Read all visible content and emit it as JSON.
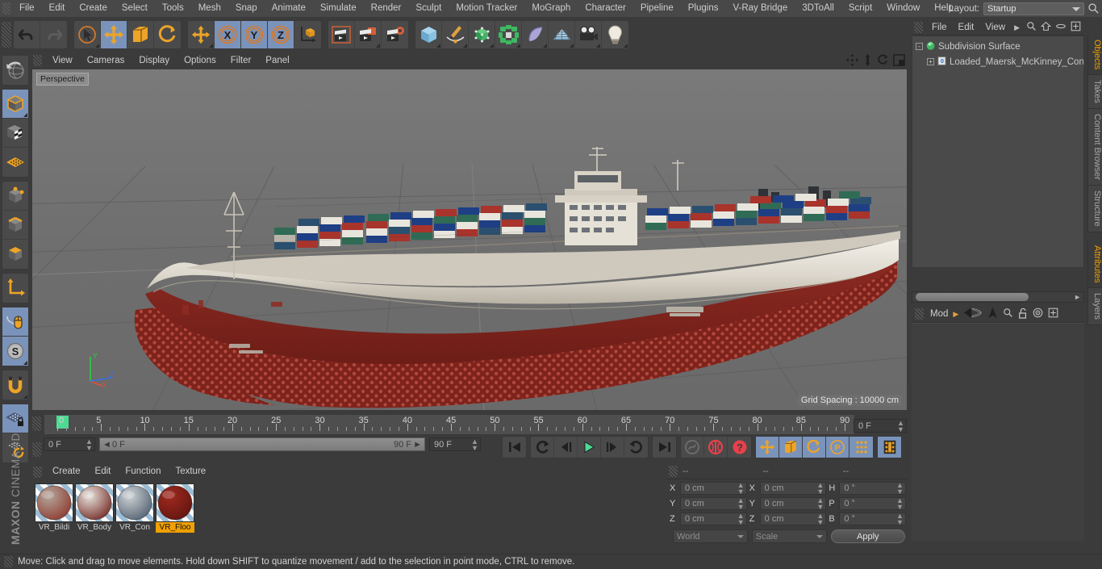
{
  "app": {
    "title": "MAXON CINEMA 4D",
    "brand_top": "MAXON",
    "brand_bottom": "CINEMA 4D"
  },
  "menubar": {
    "items": [
      "File",
      "Edit",
      "Create",
      "Select",
      "Tools",
      "Mesh",
      "Snap",
      "Animate",
      "Simulate",
      "Render",
      "Sculpt",
      "Motion Tracker",
      "MoGraph",
      "Character",
      "Pipeline",
      "Plugins",
      "V-Ray Bridge",
      "3DToAll",
      "Script",
      "Window",
      "Help"
    ],
    "layout_label": "Layout:",
    "layout_value": "Startup",
    "search_icon": "search-icon"
  },
  "main_toolbar": {
    "groups": [
      {
        "name": "history",
        "buttons": [
          {
            "name": "undo",
            "icon": "undo-icon",
            "selected": false,
            "has_corner": false
          },
          {
            "name": "redo",
            "icon": "redo-icon",
            "selected": false,
            "has_corner": false
          }
        ]
      },
      {
        "name": "transform-tools",
        "buttons": [
          {
            "name": "live-selection",
            "icon": "live-selection-icon",
            "selected": false,
            "has_corner": true
          },
          {
            "name": "move",
            "icon": "move-icon",
            "selected": true,
            "has_corner": false
          },
          {
            "name": "scale",
            "icon": "scale-icon",
            "selected": false,
            "has_corner": false
          },
          {
            "name": "rotate",
            "icon": "rotate-icon",
            "selected": false,
            "has_corner": false
          }
        ]
      },
      {
        "name": "axis-lock",
        "buttons": [
          {
            "name": "move-alt",
            "icon": "move-icon",
            "selected": false,
            "has_corner": true
          },
          {
            "name": "lock-x",
            "icon": "x-axis-icon",
            "label": "X",
            "selected": true,
            "has_corner": false
          },
          {
            "name": "lock-y",
            "icon": "y-axis-icon",
            "label": "Y",
            "selected": true,
            "has_corner": false
          },
          {
            "name": "lock-z",
            "icon": "z-axis-icon",
            "label": "Z",
            "selected": true,
            "has_corner": false
          },
          {
            "name": "world-coordinate-system",
            "icon": "world-axis-icon",
            "selected": false,
            "has_corner": false
          }
        ]
      },
      {
        "name": "render",
        "buttons": [
          {
            "name": "render-view",
            "icon": "render-view-icon",
            "selected": false,
            "has_corner": false
          },
          {
            "name": "render-to-picture-viewer",
            "icon": "render-picture-viewer-icon",
            "selected": false,
            "has_corner": true
          },
          {
            "name": "edit-render-settings",
            "icon": "render-settings-icon",
            "selected": false,
            "has_corner": false
          }
        ]
      },
      {
        "name": "create",
        "buttons": [
          {
            "name": "add-cube-object",
            "icon": "cube-icon",
            "selected": false,
            "has_corner": true
          },
          {
            "name": "add-spline",
            "icon": "pen-spline-icon",
            "selected": false,
            "has_corner": true
          },
          {
            "name": "add-generator",
            "icon": "generator-icon",
            "selected": false,
            "has_corner": true
          },
          {
            "name": "add-mograph",
            "icon": "mograph-icon",
            "selected": false,
            "has_corner": true
          },
          {
            "name": "add-deformer",
            "icon": "deformer-icon",
            "selected": false,
            "has_corner": true
          },
          {
            "name": "add-environment",
            "icon": "floor-environment-icon",
            "selected": false,
            "has_corner": true
          },
          {
            "name": "add-camera",
            "icon": "camera-icon",
            "selected": false,
            "has_corner": true
          },
          {
            "name": "add-light",
            "icon": "light-bulb-icon",
            "selected": false,
            "has_corner": true
          }
        ]
      }
    ]
  },
  "left_toolbar": {
    "groups": [
      {
        "name": "undo-view",
        "buttons": [
          {
            "name": "undo-view",
            "icon": "globe-undo-icon",
            "selected": false,
            "has_corner": false
          }
        ]
      },
      {
        "name": "editor-mode",
        "buttons": [
          {
            "name": "make-editable",
            "icon": "editable-cube-icon",
            "selected": true,
            "has_corner": true
          },
          {
            "name": "texture-axis-mode",
            "icon": "texture-cube-icon",
            "selected": false,
            "has_corner": false
          },
          {
            "name": "enable-axis-modification",
            "icon": "axis-grid-icon",
            "selected": false,
            "has_corner": false
          }
        ]
      },
      {
        "name": "component-mode",
        "buttons": [
          {
            "name": "points-mode",
            "icon": "points-cube-icon",
            "selected": false,
            "has_corner": false
          },
          {
            "name": "edges-mode",
            "icon": "edges-cube-icon",
            "selected": false,
            "has_corner": false
          },
          {
            "name": "polygons-mode",
            "icon": "polygons-cube-icon",
            "selected": false,
            "has_corner": false
          }
        ]
      },
      {
        "name": "model-axis",
        "buttons": [
          {
            "name": "object-axis-mode",
            "icon": "axis-arrow-icon",
            "selected": false,
            "has_corner": false
          }
        ]
      },
      {
        "name": "viewport-interaction",
        "buttons": [
          {
            "name": "viewport-solo-off",
            "icon": "mouse-viewport-icon",
            "selected": true,
            "has_corner": false
          },
          {
            "name": "soft-selection",
            "icon": "soft-selection-icon",
            "selected": true,
            "has_corner": true
          }
        ]
      },
      {
        "name": "snapping",
        "buttons": [
          {
            "name": "enable-snap",
            "icon": "magnet-icon",
            "selected": false,
            "has_corner": true
          }
        ]
      },
      {
        "name": "workplane",
        "buttons": [
          {
            "name": "lock-workplane",
            "icon": "workplane-lock-icon",
            "selected": true,
            "has_corner": false
          },
          {
            "name": "planar-workplane",
            "icon": "workplane-rotate-icon",
            "selected": false,
            "has_corner": false
          }
        ]
      }
    ]
  },
  "viewport": {
    "menu": [
      "View",
      "Cameras",
      "Display",
      "Options",
      "Filter",
      "Panel"
    ],
    "nav_icons": [
      "pan-icon",
      "zoom-icon",
      "rotate-icon",
      "maximize-viewport-icon"
    ],
    "perspective_label": "Perspective",
    "grid_spacing": "Grid Spacing : 10000 cm",
    "axis_labels": {
      "x": "X",
      "y": "Y",
      "z": "Z"
    },
    "scene_object": "Loaded_Maersk_McKinney_Container_Ship"
  },
  "timeline": {
    "start_frame_field": "0 F",
    "range_start": "0 F",
    "range_end": "90 F",
    "end_frame_field": "90 F",
    "current_frame_field": "0 F",
    "tick_labels": [
      "0",
      "5",
      "10",
      "15",
      "20",
      "25",
      "30",
      "35",
      "40",
      "45",
      "50",
      "55",
      "60",
      "65",
      "70",
      "75",
      "80",
      "85",
      "90"
    ],
    "tick_values": [
      0,
      5,
      10,
      15,
      20,
      25,
      30,
      35,
      40,
      45,
      50,
      55,
      60,
      65,
      70,
      75,
      80,
      85,
      90
    ],
    "min": 0,
    "max": 90,
    "playhead_frame": 0,
    "transport": [
      {
        "name": "go-to-start",
        "icon": "skip-start-icon",
        "selected": false
      },
      {
        "name": "previous-key",
        "icon": "prev-key-icon",
        "selected": false
      },
      {
        "name": "step-back",
        "icon": "step-back-icon",
        "selected": false
      },
      {
        "name": "play-forwards",
        "icon": "play-icon",
        "selected": false
      },
      {
        "name": "step-forward",
        "icon": "step-forward-icon",
        "selected": false
      },
      {
        "name": "next-key",
        "icon": "next-key-icon",
        "selected": false
      },
      {
        "name": "go-to-end",
        "icon": "skip-end-icon",
        "selected": false
      },
      {
        "name": "record-active-objects",
        "icon": "record-key-icon",
        "selected": false
      },
      {
        "name": "autokeying",
        "icon": "autokey-icon",
        "selected": false
      },
      {
        "name": "keyframe-selection",
        "icon": "keyframe-selection-icon",
        "selected": false
      },
      {
        "name": "record-position",
        "icon": "record-position-icon",
        "selected": true
      },
      {
        "name": "record-scale",
        "icon": "record-scale-icon",
        "selected": true
      },
      {
        "name": "record-rotation",
        "icon": "record-rotation-icon",
        "selected": true
      },
      {
        "name": "record-parameter",
        "icon": "record-parameter-icon",
        "selected": true
      },
      {
        "name": "record-pla",
        "icon": "record-pla-icon",
        "selected": true
      },
      {
        "name": "animation-layers",
        "icon": "filmstrip-icon",
        "selected": true
      }
    ]
  },
  "material_manager": {
    "menu": [
      "Create",
      "Edit",
      "Function",
      "Texture"
    ],
    "materials": [
      {
        "name": "VR_Bildi",
        "selected": false,
        "color_a": "#b4a79d",
        "color_b": "#8c3327"
      },
      {
        "name": "VR_Body",
        "selected": false,
        "color_a": "#e8e4de",
        "color_b": "#6d1f1a"
      },
      {
        "name": "VR_Con",
        "selected": false,
        "color_a": "#cfd3d6",
        "color_b": "#4a5a6b"
      },
      {
        "name": "VR_Floo",
        "selected": true,
        "color_a": "#9f2a20",
        "color_b": "#5d140f"
      }
    ]
  },
  "coordinates": {
    "headers": [
      "--",
      "--",
      "--"
    ],
    "rows": [
      {
        "pos_label": "X",
        "pos_value": "0 cm",
        "size_label": "X",
        "size_value": "0 cm",
        "rot_label": "H",
        "rot_value": "0 °"
      },
      {
        "pos_label": "Y",
        "pos_value": "0 cm",
        "size_label": "Y",
        "size_value": "0 cm",
        "rot_label": "P",
        "rot_value": "0 °"
      },
      {
        "pos_label": "Z",
        "pos_value": "0 cm",
        "size_label": "Z",
        "size_value": "0 cm",
        "rot_label": "B",
        "rot_value": "0 °"
      }
    ],
    "coord_system": "World",
    "size_mode": "Scale",
    "apply_label": "Apply"
  },
  "object_manager": {
    "menu": [
      "File",
      "Edit",
      "View"
    ],
    "menu_more_icon": "chevron-right-icon",
    "icons": [
      "search-icon",
      "home-icon",
      "ellipse-icon",
      "plus-box-icon"
    ],
    "tree": [
      {
        "name": "Subdivision Surface",
        "depth": 0,
        "icon": "subdivision-surface-icon",
        "expander": "-"
      },
      {
        "name": "Loaded_Maersk_McKinney_Conta",
        "depth": 1,
        "icon": "null-object-icon",
        "expander": "+"
      }
    ]
  },
  "attribute_manager": {
    "label": "Mod",
    "more_icon": "chevron-right-icon",
    "icons": [
      "tool-cone-icon",
      "up-arrow-icon",
      "search-icon",
      "unlock-icon",
      "target-icon",
      "plus-box-icon"
    ]
  },
  "vertical_tabs": {
    "upper": [
      {
        "label": "Objects",
        "active": true
      },
      {
        "label": "Takes",
        "active": false
      },
      {
        "label": "Content Browser",
        "active": false
      },
      {
        "label": "Structure",
        "active": false
      }
    ],
    "lower": [
      {
        "label": "Attributes",
        "active": true
      },
      {
        "label": "Layers",
        "active": false
      }
    ]
  },
  "statusbar": {
    "text": "Move: Click and drag to move elements. Hold down SHIFT to quantize movement / add to the selection in point mode, CTRL to remove."
  },
  "colors": {
    "accent_orange": "#f0a000",
    "selected_blue": "#7a93bb",
    "panel_bg": "#3b3b3b",
    "viewport_bg": "#6e6e6e",
    "playhead_green": "#4ddb93"
  }
}
